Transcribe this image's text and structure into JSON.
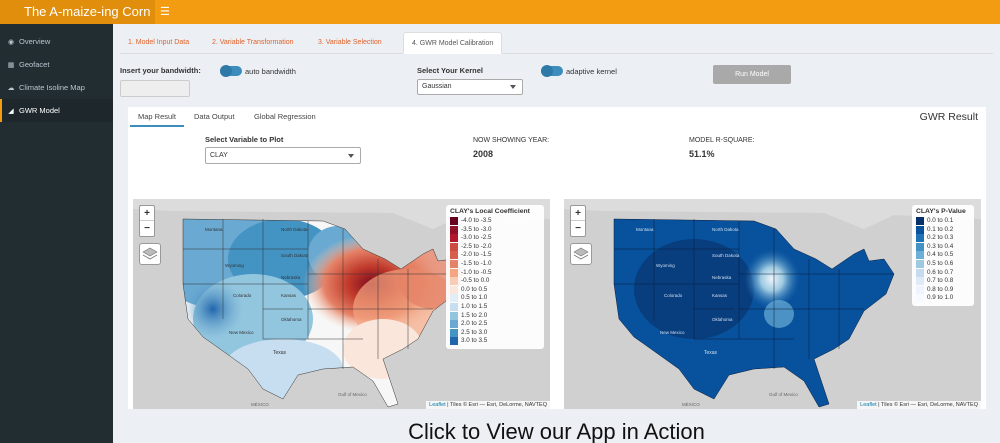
{
  "app": {
    "title": "The A-maize-ing Corn"
  },
  "sidebar": {
    "items": [
      {
        "label": "Overview",
        "icon": "gauge-icon"
      },
      {
        "label": "Geofacet",
        "icon": "map-icon"
      },
      {
        "label": "Climate Isoline Map",
        "icon": "cloud-icon"
      },
      {
        "label": "GWR Model",
        "icon": "chart-icon",
        "active": true
      }
    ]
  },
  "tabs": [
    "1. Model Input Data",
    "2. Variable Transformation",
    "3. Variable Selection",
    "4. GWR Model Calibration"
  ],
  "controls": {
    "bandwidth_label": "Insert your bandwidth:",
    "auto_bandwidth": "auto bandwidth",
    "kernel_label": "Select Your Kernel",
    "kernel_value": "Gaussian",
    "adaptive_kernel": "adaptive kernel",
    "run_button": "Run Model"
  },
  "panel": {
    "tabs": [
      "Map Result",
      "Data Output",
      "Global Regression"
    ],
    "title": "GWR Result",
    "variable_label": "Select Variable to Plot",
    "variable_value": "CLAY",
    "year_label": "NOW SHOWING YEAR:",
    "year_value": "2008",
    "rsq_label": "MODEL R-SQUARE:",
    "rsq_value": "51.1%"
  },
  "maps": {
    "left_legend": {
      "title": "CLAY's Local Coefficient",
      "entries": [
        "-4.0 to -3.5",
        "-3.5 to -3.0",
        "-3.0 to -2.5",
        "-2.5 to -2.0",
        "-2.0 to -1.5",
        "-1.5 to -1.0",
        "-1.0 to -0.5",
        "-0.5 to 0.0",
        "0.0 to 0.5",
        "0.5 to 1.0",
        "1.0 to 1.5",
        "1.5 to 2.0",
        "2.0 to 2.5",
        "2.5 to 3.0",
        "3.0 to 3.5"
      ],
      "colors": [
        "#67001f",
        "#8f1127",
        "#b2182b",
        "#cc4c43",
        "#d6604d",
        "#e58267",
        "#f4a582",
        "#f8cdb5",
        "#fbe6dc",
        "#e2eef6",
        "#c6def0",
        "#92c5de",
        "#6aa9d1",
        "#4393c3",
        "#2166ac"
      ]
    },
    "right_legend": {
      "title": "CLAY's P-Value",
      "entries": [
        "0.0 to 0.1",
        "0.1 to 0.2",
        "0.2 to 0.3",
        "0.3 to 0.4",
        "0.4 to 0.5",
        "0.5 to 0.6",
        "0.6 to 0.7",
        "0.7 to 0.8",
        "0.8 to 0.9",
        "0.9 to 1.0"
      ],
      "colors": [
        "#08306b",
        "#08519c",
        "#2171b5",
        "#4292c6",
        "#6baed6",
        "#9ecae1",
        "#c6dbef",
        "#deebf7",
        "#eff3ff",
        "#f7fbff"
      ]
    },
    "attribution_link": "Leaflet",
    "attribution_text": " | Tiles © Esri — Esri, DeLorme, NAVTEQ",
    "labels": {
      "montana": "Montana",
      "wyoming": "Wyoming",
      "colorado": "Colorado",
      "newmexico": "New Mexico",
      "texas": "Texas",
      "mexico": "MÉXICO",
      "gulf": "Gulf of Mexico",
      "northdakota": "North Dakota",
      "southdakota": "South Dakota",
      "nebraska": "Nebraska",
      "kansas": "Kansas",
      "oklahoma": "Oklahoma"
    }
  },
  "caption": "Click to View our App in Action"
}
